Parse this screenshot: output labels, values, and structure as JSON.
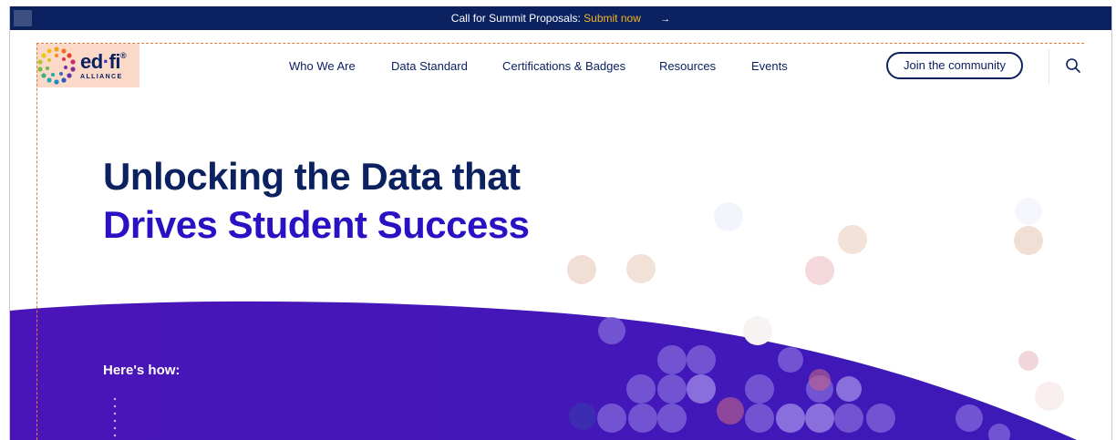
{
  "announcement": {
    "text": "Call for Summit Proposals:",
    "link_text": "Submit now",
    "arrow": "→"
  },
  "logo": {
    "name_left": "ed",
    "name_dot": "·",
    "name_right": "fi",
    "registered": "®",
    "tagline": "ALLIANCE"
  },
  "nav": {
    "items": [
      {
        "label": "Who We Are"
      },
      {
        "label": "Data Standard"
      },
      {
        "label": "Certifications & Badges"
      },
      {
        "label": "Resources"
      },
      {
        "label": "Events"
      }
    ],
    "join_label": "Join the community",
    "search_icon": "search-icon"
  },
  "hero": {
    "line1": "Unlocking the Data that",
    "line2": "Drives Student Success"
  },
  "section": {
    "heading": "Here's how:"
  },
  "colors": {
    "navy": "#0b2160",
    "purple": "#4a12c0",
    "accent": "#f3b71e",
    "logo_bg": "#fbd9c8"
  }
}
